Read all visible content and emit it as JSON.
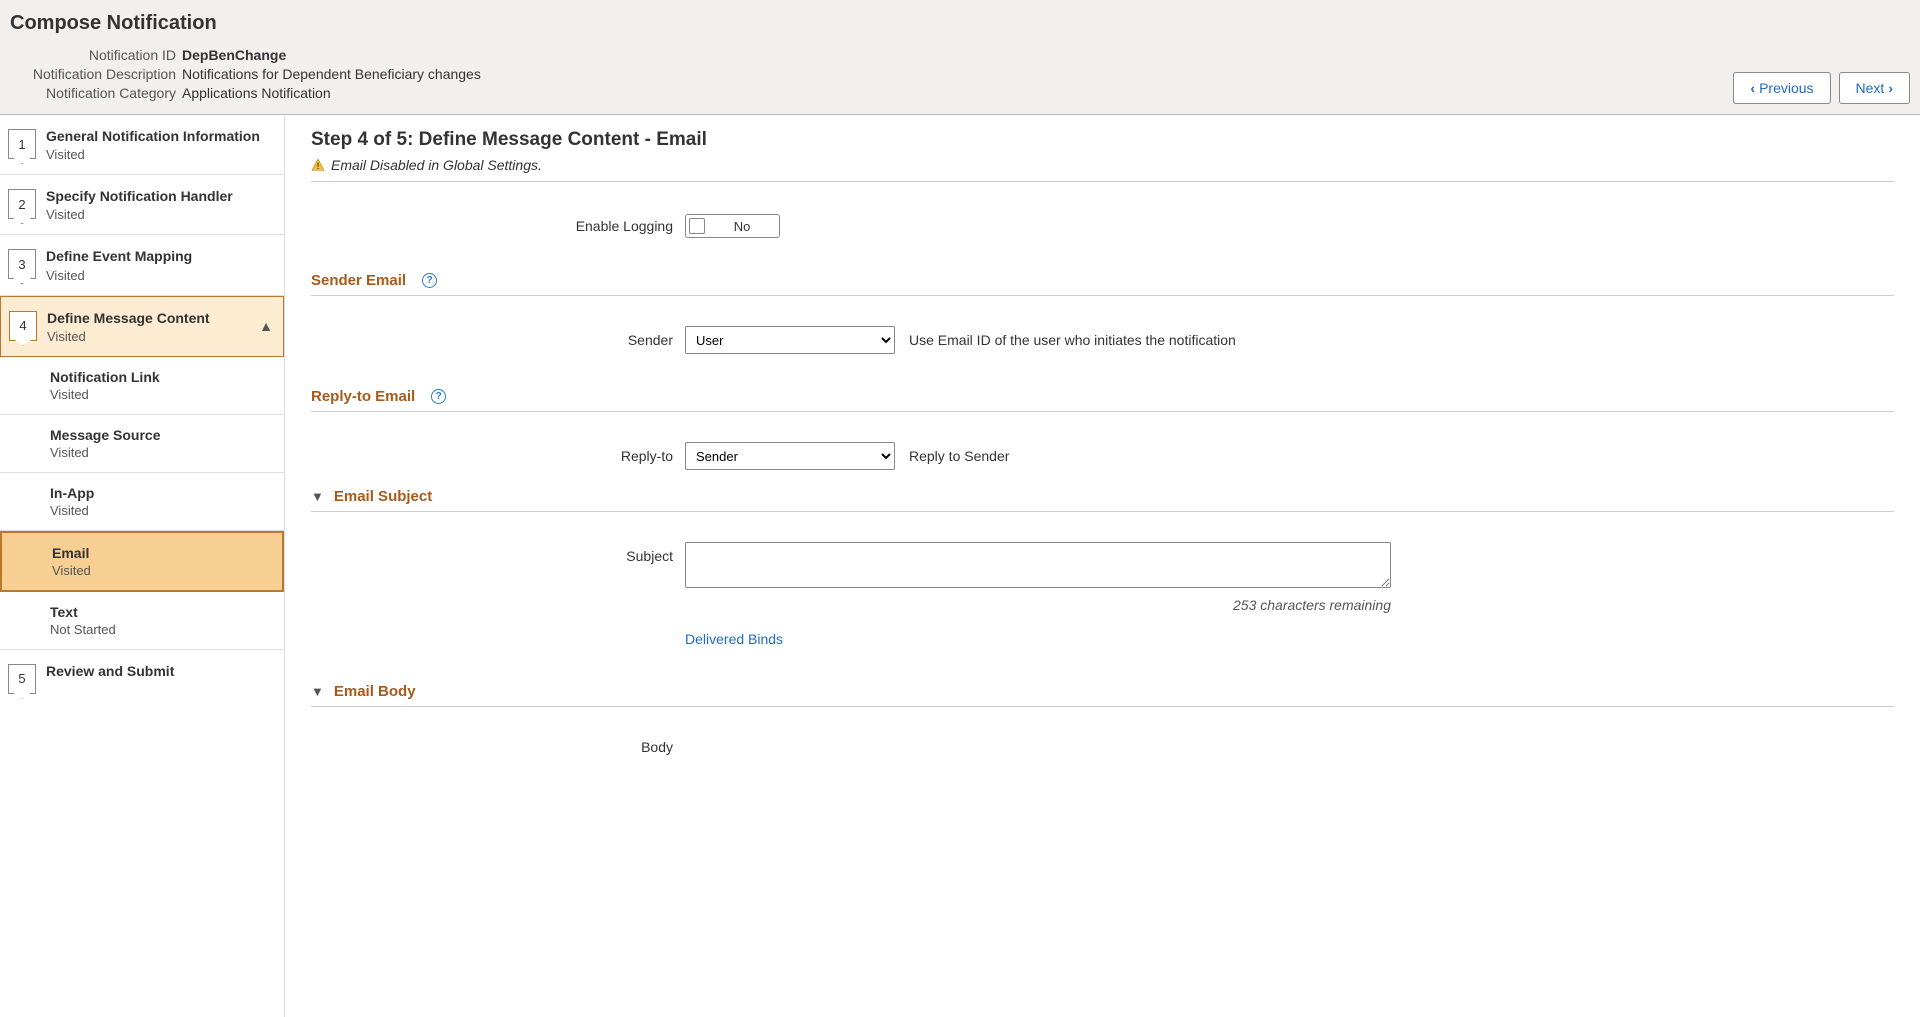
{
  "header": {
    "title": "Compose Notification",
    "meta": {
      "id_label": "Notification ID",
      "id_value": "DepBenChange",
      "desc_label": "Notification Description",
      "desc_value": "Notifications for Dependent Beneficiary changes",
      "cat_label": "Notification Category",
      "cat_value": "Applications Notification"
    },
    "nav": {
      "prev": "Previous",
      "next": "Next"
    }
  },
  "sidebar": {
    "steps": [
      {
        "num": "1",
        "title": "General Notification Information",
        "status": "Visited"
      },
      {
        "num": "2",
        "title": "Specify Notification Handler",
        "status": "Visited"
      },
      {
        "num": "3",
        "title": "Define Event Mapping",
        "status": "Visited"
      },
      {
        "num": "4",
        "title": "Define Message Content",
        "status": "Visited"
      },
      {
        "num": "5",
        "title": "Review and Submit",
        "status": ""
      }
    ],
    "substeps": [
      {
        "title": "Notification Link",
        "status": "Visited"
      },
      {
        "title": "Message Source",
        "status": "Visited"
      },
      {
        "title": "In-App",
        "status": "Visited"
      },
      {
        "title": "Email",
        "status": "Visited"
      },
      {
        "title": "Text",
        "status": "Not Started"
      }
    ]
  },
  "main": {
    "step_title": "Step 4 of 5: Define Message Content - Email",
    "warning": "Email Disabled in Global Settings.",
    "enable_logging_label": "Enable Logging",
    "enable_logging_value": "No",
    "sender_section": "Sender Email",
    "sender_label": "Sender",
    "sender_selected": "User",
    "sender_hint": "Use Email ID of the user who initiates the notification",
    "replyto_section": "Reply-to Email",
    "replyto_label": "Reply-to",
    "replyto_selected": "Sender",
    "replyto_hint": "Reply to Sender",
    "subject_section": "Email Subject",
    "subject_label": "Subject",
    "subject_value": "",
    "chars_remaining": "253 characters remaining",
    "delivered_binds": "Delivered Binds",
    "body_section": "Email Body",
    "body_label": "Body"
  }
}
